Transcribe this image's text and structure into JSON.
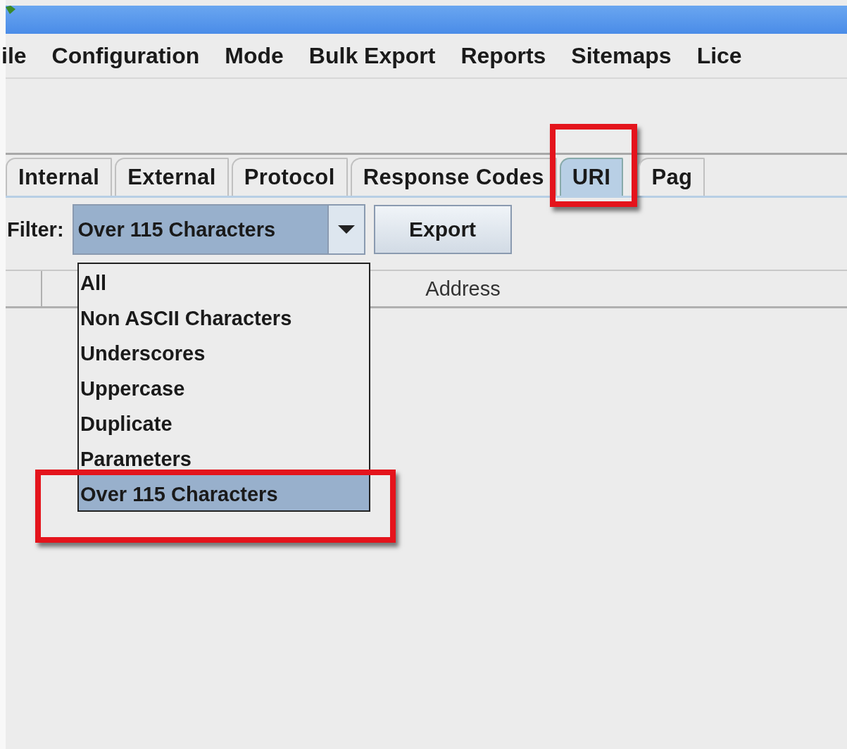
{
  "menu": [
    "ile",
    "Configuration",
    "Mode",
    "Bulk Export",
    "Reports",
    "Sitemaps",
    "Lice"
  ],
  "tabs": [
    {
      "label": "Internal",
      "selected": false
    },
    {
      "label": "External",
      "selected": false
    },
    {
      "label": "Protocol",
      "selected": false
    },
    {
      "label": "Response Codes",
      "selected": false
    },
    {
      "label": "URI",
      "selected": true
    },
    {
      "label": "Pag",
      "selected": false
    }
  ],
  "filter": {
    "label": "Filter:",
    "value": "Over 115 Characters",
    "options": [
      {
        "label": "All",
        "selected": false
      },
      {
        "label": "Non ASCII Characters",
        "selected": false
      },
      {
        "label": "Underscores",
        "selected": false
      },
      {
        "label": "Uppercase",
        "selected": false
      },
      {
        "label": "Duplicate",
        "selected": false
      },
      {
        "label": "Parameters",
        "selected": false
      },
      {
        "label": "Over 115 Characters",
        "selected": true
      }
    ]
  },
  "export_button": "Export",
  "table": {
    "column_header": "Address"
  }
}
